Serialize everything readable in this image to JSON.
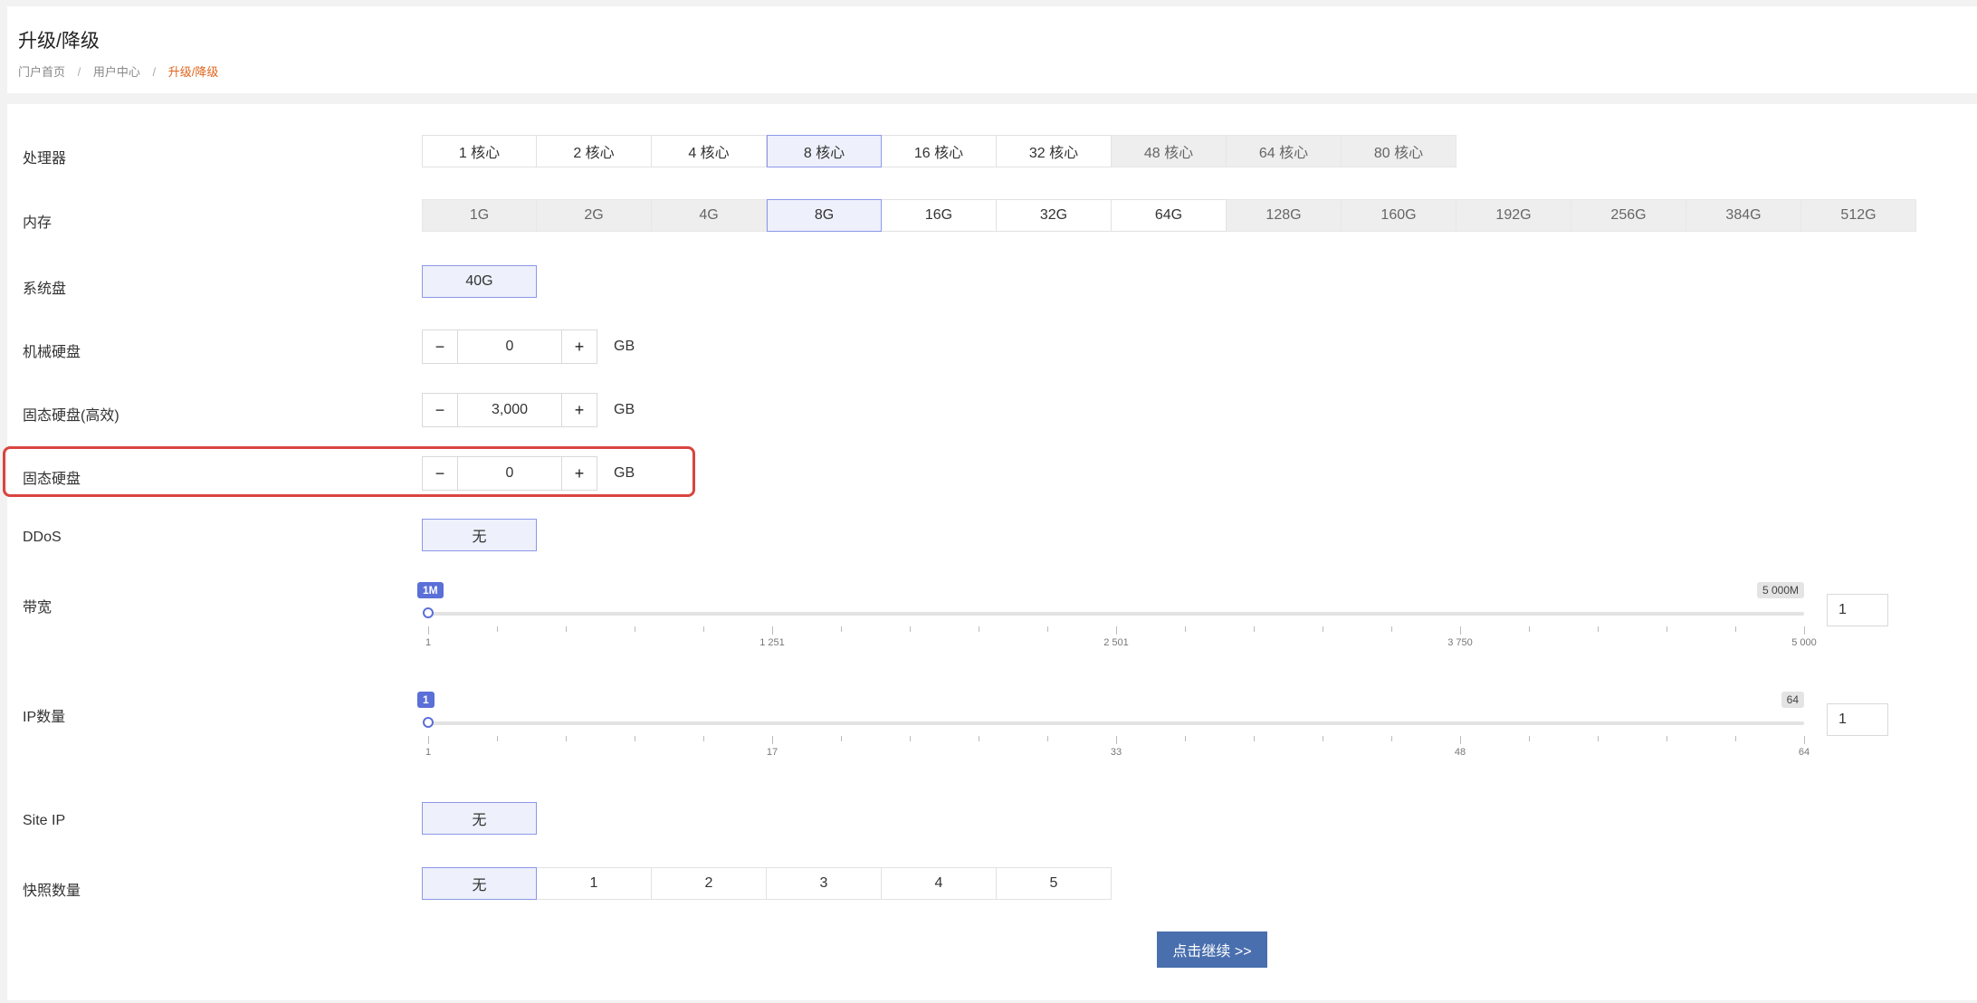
{
  "page": {
    "title": "升级/降级",
    "breadcrumb": [
      "门户首页",
      "用户中心",
      "升级/降级"
    ]
  },
  "cpu": {
    "label": "处理器",
    "options": [
      {
        "label": "1 核心",
        "state": "normal"
      },
      {
        "label": "2 核心",
        "state": "normal"
      },
      {
        "label": "4 核心",
        "state": "normal"
      },
      {
        "label": "8 核心",
        "state": "selected"
      },
      {
        "label": "16 核心",
        "state": "normal"
      },
      {
        "label": "32 核心",
        "state": "normal"
      },
      {
        "label": "48 核心",
        "state": "disabled"
      },
      {
        "label": "64 核心",
        "state": "disabled"
      },
      {
        "label": "80 核心",
        "state": "disabled"
      }
    ]
  },
  "memory": {
    "label": "内存",
    "options": [
      {
        "label": "1G",
        "state": "disabled"
      },
      {
        "label": "2G",
        "state": "disabled"
      },
      {
        "label": "4G",
        "state": "disabled"
      },
      {
        "label": "8G",
        "state": "selected"
      },
      {
        "label": "16G",
        "state": "normal"
      },
      {
        "label": "32G",
        "state": "normal"
      },
      {
        "label": "64G",
        "state": "normal"
      },
      {
        "label": "128G",
        "state": "disabled"
      },
      {
        "label": "160G",
        "state": "disabled"
      },
      {
        "label": "192G",
        "state": "disabled"
      },
      {
        "label": "256G",
        "state": "disabled"
      },
      {
        "label": "384G",
        "state": "disabled"
      },
      {
        "label": "512G",
        "state": "disabled"
      }
    ]
  },
  "system_disk": {
    "label": "系统盘",
    "options": [
      {
        "label": "40G",
        "state": "selected"
      }
    ]
  },
  "hdd": {
    "label": "机械硬盘",
    "value": "0",
    "unit": "GB",
    "minus": "−",
    "plus": "+"
  },
  "ssd_efficient": {
    "label": "固态硬盘(高效)",
    "value": "3,000",
    "unit": "GB",
    "minus": "−",
    "plus": "+"
  },
  "ssd": {
    "label": "固态硬盘",
    "value": "0",
    "unit": "GB",
    "minus": "−",
    "plus": "+"
  },
  "ddos": {
    "label": "DDoS",
    "options": [
      {
        "label": "无",
        "state": "selected"
      }
    ]
  },
  "bandwidth": {
    "label": "带宽",
    "min_badge": "1M",
    "max_badge": "5 000M",
    "value": 1,
    "min": 1,
    "max": 5000,
    "tick_labels": [
      "1",
      "1 251",
      "2 501",
      "3 750",
      "5 000"
    ],
    "input_value": "1"
  },
  "ip_count": {
    "label": "IP数量",
    "min_badge": "1",
    "max_badge": "64",
    "value": 1,
    "min": 1,
    "max": 64,
    "tick_labels": [
      "1",
      "17",
      "33",
      "48",
      "64"
    ],
    "input_value": "1"
  },
  "site_ip": {
    "label": "Site IP",
    "options": [
      {
        "label": "无",
        "state": "selected"
      }
    ]
  },
  "snapshots": {
    "label": "快照数量",
    "options": [
      {
        "label": "无",
        "state": "selected"
      },
      {
        "label": "1",
        "state": "normal"
      },
      {
        "label": "2",
        "state": "normal"
      },
      {
        "label": "3",
        "state": "normal"
      },
      {
        "label": "4",
        "state": "normal"
      },
      {
        "label": "5",
        "state": "normal"
      }
    ]
  },
  "continue_label": "点击继续 >>",
  "colors": {
    "accent": "#5b6fd8",
    "selected_bg": "#eef0fb",
    "highlight": "#d9453f",
    "button": "#4a6fae",
    "breadcrumb_current": "#e0661f"
  }
}
